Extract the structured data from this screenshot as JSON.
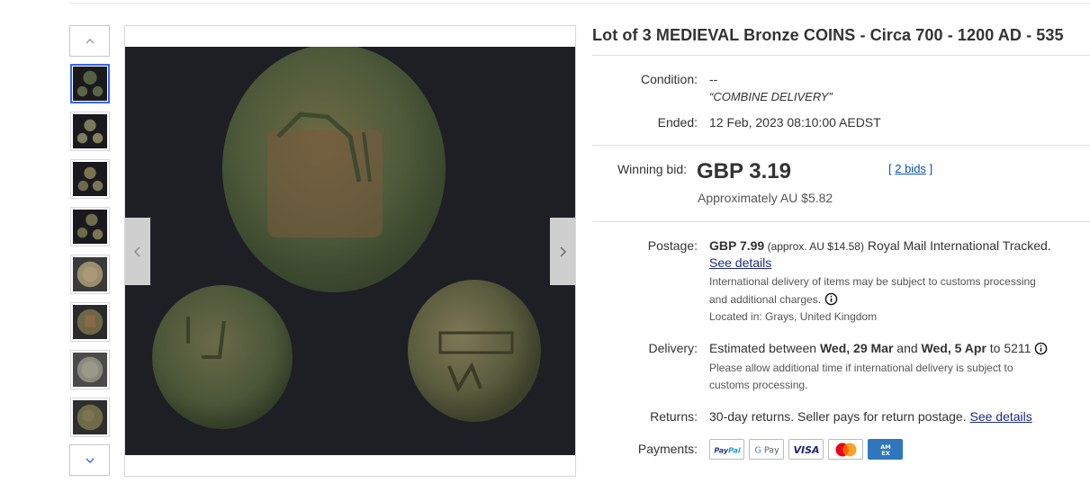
{
  "listing": {
    "title": "Lot of 3 MEDIEVAL Bronze COINS - Circa 700 - 1200 AD - 535"
  },
  "details": {
    "condition_label": "Condition:",
    "condition_value": "--",
    "condition_note": "“COMBINE DELIVERY”",
    "ended_label": "Ended:",
    "ended_value": "12 Feb, 2023 08:10:00 AEDST",
    "winning_bid_label": "Winning bid:",
    "winning_bid_price": "GBP 3.19",
    "winning_bid_approx": "Approximately AU $5.82",
    "bids_open": "[ ",
    "bids_link": "2 bids",
    "bids_close": " ]"
  },
  "shipping": {
    "postage_label": "Postage:",
    "postage_price": "GBP 7.99",
    "postage_approx": " (approx. AU $14.58)",
    "postage_service": " Royal Mail International Tracked.",
    "see_details": "See details",
    "customs_line1": "International delivery of items may be subject to customs processing",
    "customs_line2": "and additional charges.",
    "located_in": "Located in: Grays, United Kingdom",
    "delivery_label": "Delivery:",
    "delivery_prefix": "Estimated between ",
    "delivery_from": "Wed, 29 Mar",
    "delivery_and": " and ",
    "delivery_to": "Wed, 5 Apr",
    "delivery_postcode": " to 5211",
    "delivery_note1": "Please allow additional time if international delivery is subject to",
    "delivery_note2": "customs processing.",
    "returns_label": "Returns:",
    "returns_value": "30-day returns. Seller pays for return postage. ",
    "returns_link": "See details",
    "payments_label": "Payments:"
  },
  "payments": [
    {
      "name": "PayPal",
      "color": "#253b80"
    },
    {
      "name": "G Pay",
      "color": "#5f6368"
    },
    {
      "name": "VISA",
      "color": "#1a1f71"
    },
    {
      "name": "Mastercard",
      "color": "#eb001b"
    },
    {
      "name": "AMEX",
      "color": "#2e77bc"
    }
  ],
  "gallery": {
    "thumbnail_count": 8,
    "active_index": 0
  },
  "colors": {
    "link": "#1d2a85",
    "accent": "#3665f3",
    "image_bg": "#1a1a1e",
    "coin": "#4f5a3c"
  }
}
